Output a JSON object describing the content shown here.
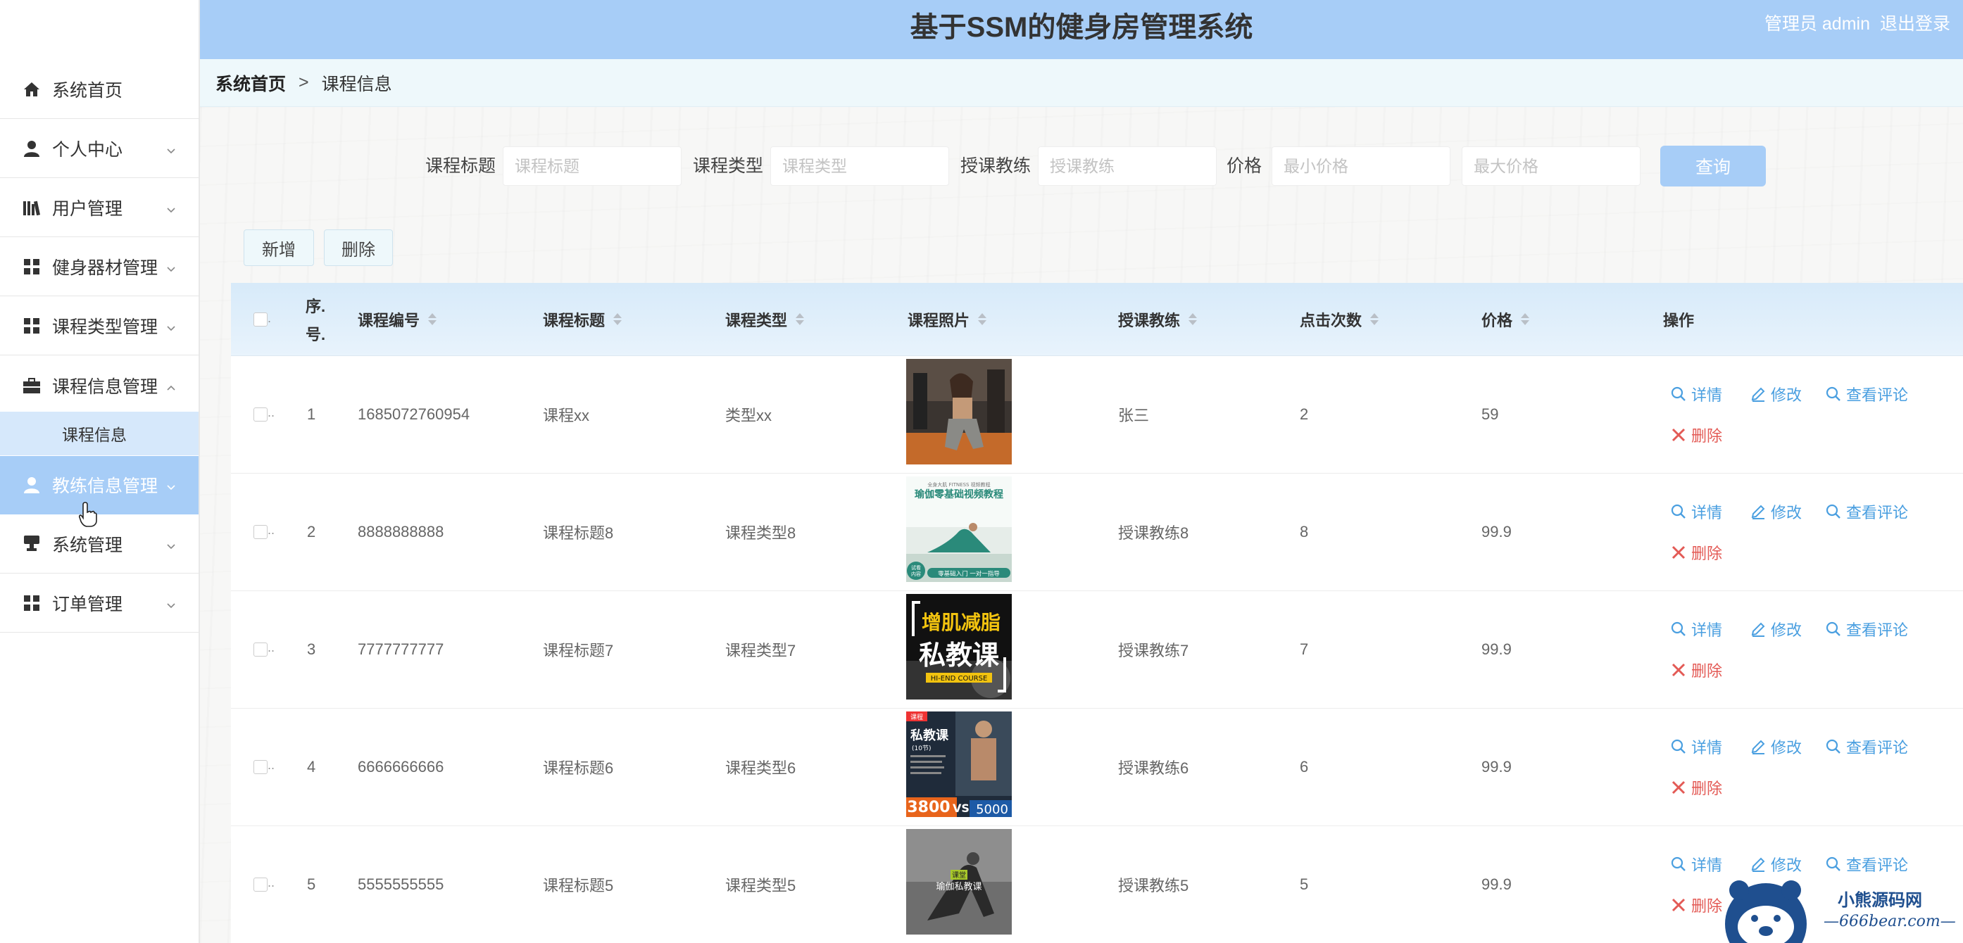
{
  "header": {
    "title": "基于SSM的健身房管理系统",
    "user_label": "管理员 admin",
    "logout": "退出登录"
  },
  "sidebar": {
    "items": [
      {
        "label": "系统首页",
        "icon": "home-icon"
      },
      {
        "label": "个人中心",
        "icon": "user-icon"
      },
      {
        "label": "用户管理",
        "icon": "books-icon"
      },
      {
        "label": "健身器材管理",
        "icon": "grid-icon"
      },
      {
        "label": "课程类型管理",
        "icon": "grid-icon"
      },
      {
        "label": "课程信息管理",
        "icon": "briefcase-icon"
      },
      {
        "label": "教练信息管理",
        "icon": "user-icon"
      },
      {
        "label": "系统管理",
        "icon": "dashboard-icon"
      },
      {
        "label": "订单管理",
        "icon": "grid-icon"
      }
    ],
    "submenu_label": "课程信息"
  },
  "breadcrumb": {
    "home": "系统首页",
    "sep": ">",
    "current": "课程信息"
  },
  "search": {
    "title_label": "课程标题",
    "title_placeholder": "课程标题",
    "type_label": "课程类型",
    "type_placeholder": "课程类型",
    "coach_label": "授课教练",
    "coach_placeholder": "授课教练",
    "price_label": "价格",
    "min_placeholder": "最小价格",
    "max_placeholder": "最大价格",
    "query": "查询"
  },
  "toolbar": {
    "add": "新增",
    "delete": "删除"
  },
  "table": {
    "headers": {
      "index1": "序.",
      "index2": "号.",
      "code": "课程编号",
      "title": "课程标题",
      "type": "课程类型",
      "photo": "课程照片",
      "coach": "授课教练",
      "clicks": "点击次数",
      "price": "价格",
      "ops": "操作"
    },
    "rows": [
      {
        "idx": "1",
        "code": "1685072760954",
        "title": "课程xx",
        "type": "类型xx",
        "coach": "张三",
        "clicks": "2",
        "price": "59"
      },
      {
        "idx": "2",
        "code": "8888888888",
        "title": "课程标题8",
        "type": "课程类型8",
        "coach": "授课教练8",
        "clicks": "8",
        "price": "99.9"
      },
      {
        "idx": "3",
        "code": "7777777777",
        "title": "课程标题7",
        "type": "课程类型7",
        "coach": "授课教练7",
        "clicks": "7",
        "price": "99.9"
      },
      {
        "idx": "4",
        "code": "6666666666",
        "title": "课程标题6",
        "type": "课程类型6",
        "coach": "授课教练6",
        "clicks": "6",
        "price": "99.9"
      },
      {
        "idx": "5",
        "code": "5555555555",
        "title": "课程标题5",
        "type": "课程类型5",
        "coach": "授课教练5",
        "clicks": "5",
        "price": "99.9"
      }
    ],
    "actions": {
      "detail": "详情",
      "edit": "修改",
      "comments": "查看评论",
      "delete": "删除"
    }
  },
  "photo_text": {
    "p2_top": "全身大肌 FITNESS 视频教程",
    "p2_title": "瑜伽零基础视频教程",
    "p2_badge": "试看 内容",
    "p2_bottom": "零基础入门 一对一指导",
    "p3_title": "增肌减脂",
    "p3_main": "私教课",
    "p3_sub": "HI-END COURSE",
    "p4_tag": "课程",
    "p4_title": "私教课",
    "p4_sub": "(10节)",
    "p4_price": "3800",
    "p4_vs": "VS",
    "p4_price2": "5000",
    "p5_tag": "课堂",
    "p5_title": "瑜伽私教课"
  },
  "watermark": {
    "name": "小熊源码网",
    "url": "—666bear.com—"
  },
  "colors": {
    "accent": "#a7cdf7",
    "link": "#4a9fe0",
    "danger": "#e35a55"
  }
}
